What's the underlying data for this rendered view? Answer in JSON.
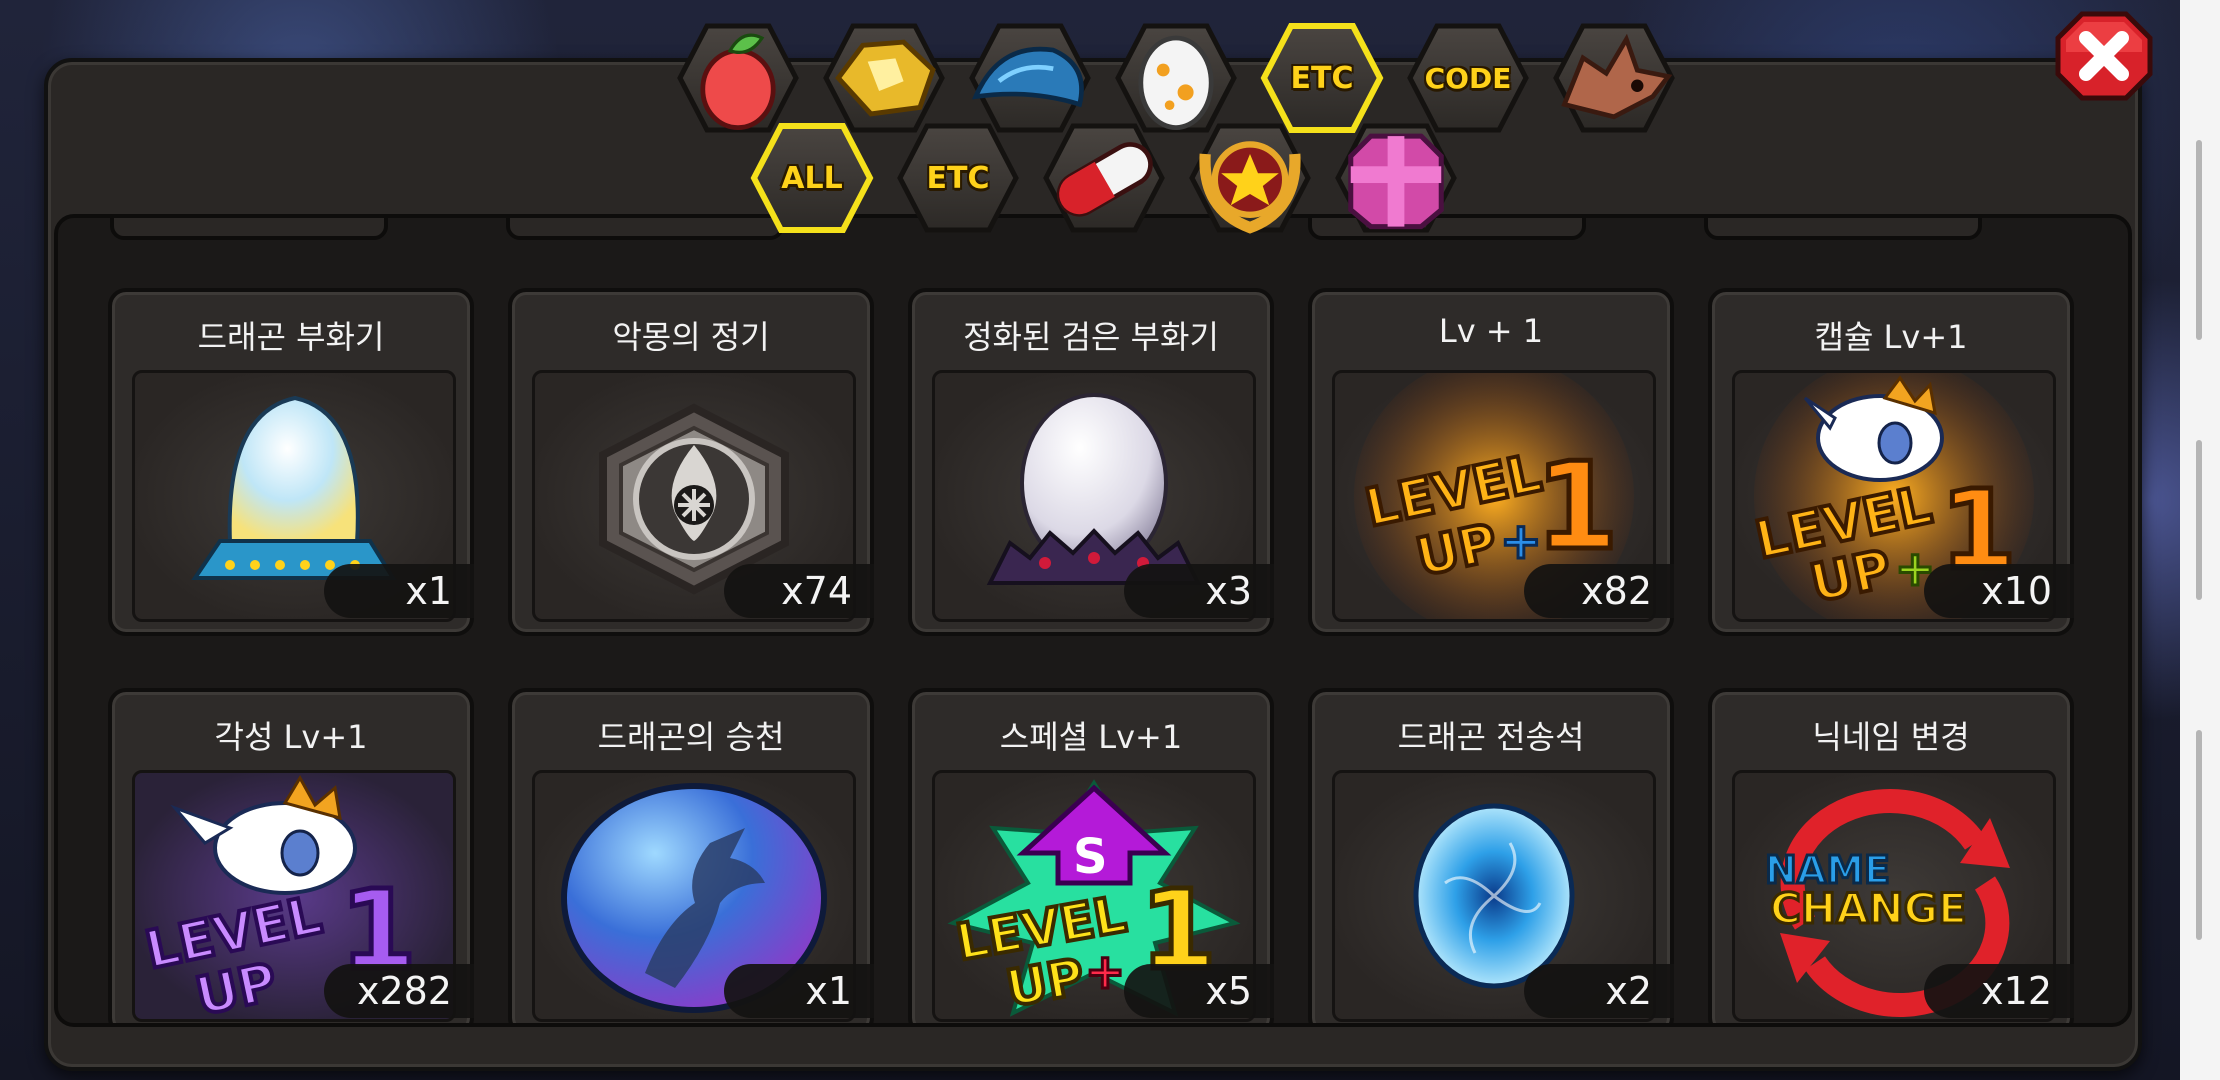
{
  "tabs_row1": [
    {
      "name": "tab-fruit",
      "icon": "fruit-icon",
      "label": ""
    },
    {
      "name": "tab-gold",
      "icon": "gold-nugget-icon",
      "label": ""
    },
    {
      "name": "tab-dragon-scale",
      "icon": "blue-scale-icon",
      "label": ""
    },
    {
      "name": "tab-egg",
      "icon": "egg-icon",
      "label": ""
    },
    {
      "name": "tab-etc-top",
      "icon": "",
      "label": "ETC",
      "selected": true
    },
    {
      "name": "tab-code",
      "icon": "",
      "label": "CODE"
    },
    {
      "name": "tab-dragon-head",
      "icon": "dragon-head-icon",
      "label": ""
    }
  ],
  "tabs_row2": [
    {
      "name": "tab-all",
      "icon": "",
      "label": "ALL",
      "selected": true
    },
    {
      "name": "tab-etc-sub",
      "icon": "",
      "label": "ETC"
    },
    {
      "name": "tab-capsule",
      "icon": "capsule-pill-icon",
      "label": ""
    },
    {
      "name": "tab-star-medal",
      "icon": "star-medal-icon",
      "label": ""
    },
    {
      "name": "tab-gift-box",
      "icon": "gift-box-icon",
      "label": ""
    }
  ],
  "items": [
    {
      "title": "드래곤 부화기",
      "qty": "x1",
      "icon": "crystal-incubator-icon"
    },
    {
      "title": "악몽의 정기",
      "qty": "x74",
      "icon": "nightmare-emblem-icon"
    },
    {
      "title": "정화된 검은 부화기",
      "qty": "x3",
      "icon": "purified-dark-incubator-icon"
    },
    {
      "title": "Lv + 1",
      "qty": "x82",
      "icon": "level-up-plus-one-icon"
    },
    {
      "title": "캡슐 Lv+1",
      "qty": "x10",
      "icon": "capsule-level-up-icon"
    },
    {
      "title": "각성 Lv+1",
      "qty": "x282",
      "icon": "awakening-level-up-icon"
    },
    {
      "title": "드래곤의 승천",
      "qty": "x1",
      "icon": "dragon-ascension-orb-icon"
    },
    {
      "title": "스페셜 Lv+1",
      "qty": "x5",
      "icon": "special-level-up-icon"
    },
    {
      "title": "드래곤 전송석",
      "qty": "x2",
      "icon": "dragon-transfer-stone-icon"
    },
    {
      "title": "닉네임 변경",
      "qty": "x12",
      "icon": "name-change-icon"
    }
  ],
  "colors": {
    "tab_selected_border": "#f5e11b",
    "tab_text": "#ffd21a",
    "close_red": "#d8222a"
  },
  "item_art_text": {
    "level": "LEVEL",
    "up": "UP",
    "plus": "+",
    "one": "1",
    "special_s": "S",
    "name": "NAME",
    "change": "CHANGE"
  }
}
